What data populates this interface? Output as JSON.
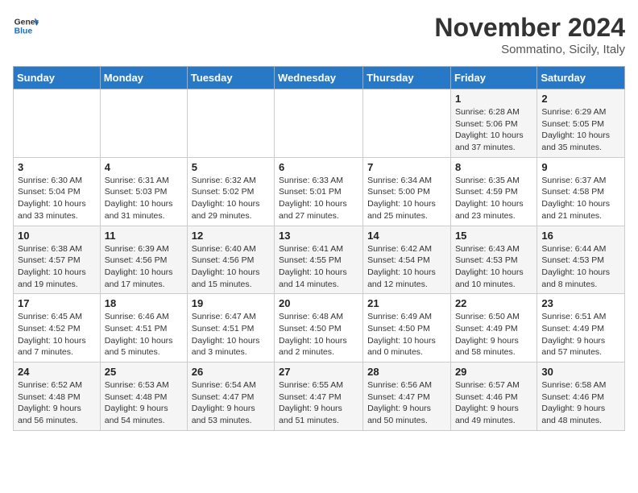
{
  "logo": {
    "line1": "General",
    "line2": "Blue"
  },
  "title": "November 2024",
  "location": "Sommatino, Sicily, Italy",
  "weekdays": [
    "Sunday",
    "Monday",
    "Tuesday",
    "Wednesday",
    "Thursday",
    "Friday",
    "Saturday"
  ],
  "weeks": [
    [
      {
        "day": "",
        "info": ""
      },
      {
        "day": "",
        "info": ""
      },
      {
        "day": "",
        "info": ""
      },
      {
        "day": "",
        "info": ""
      },
      {
        "day": "",
        "info": ""
      },
      {
        "day": "1",
        "info": "Sunrise: 6:28 AM\nSunset: 5:06 PM\nDaylight: 10 hours\nand 37 minutes."
      },
      {
        "day": "2",
        "info": "Sunrise: 6:29 AM\nSunset: 5:05 PM\nDaylight: 10 hours\nand 35 minutes."
      }
    ],
    [
      {
        "day": "3",
        "info": "Sunrise: 6:30 AM\nSunset: 5:04 PM\nDaylight: 10 hours\nand 33 minutes."
      },
      {
        "day": "4",
        "info": "Sunrise: 6:31 AM\nSunset: 5:03 PM\nDaylight: 10 hours\nand 31 minutes."
      },
      {
        "day": "5",
        "info": "Sunrise: 6:32 AM\nSunset: 5:02 PM\nDaylight: 10 hours\nand 29 minutes."
      },
      {
        "day": "6",
        "info": "Sunrise: 6:33 AM\nSunset: 5:01 PM\nDaylight: 10 hours\nand 27 minutes."
      },
      {
        "day": "7",
        "info": "Sunrise: 6:34 AM\nSunset: 5:00 PM\nDaylight: 10 hours\nand 25 minutes."
      },
      {
        "day": "8",
        "info": "Sunrise: 6:35 AM\nSunset: 4:59 PM\nDaylight: 10 hours\nand 23 minutes."
      },
      {
        "day": "9",
        "info": "Sunrise: 6:37 AM\nSunset: 4:58 PM\nDaylight: 10 hours\nand 21 minutes."
      }
    ],
    [
      {
        "day": "10",
        "info": "Sunrise: 6:38 AM\nSunset: 4:57 PM\nDaylight: 10 hours\nand 19 minutes."
      },
      {
        "day": "11",
        "info": "Sunrise: 6:39 AM\nSunset: 4:56 PM\nDaylight: 10 hours\nand 17 minutes."
      },
      {
        "day": "12",
        "info": "Sunrise: 6:40 AM\nSunset: 4:56 PM\nDaylight: 10 hours\nand 15 minutes."
      },
      {
        "day": "13",
        "info": "Sunrise: 6:41 AM\nSunset: 4:55 PM\nDaylight: 10 hours\nand 14 minutes."
      },
      {
        "day": "14",
        "info": "Sunrise: 6:42 AM\nSunset: 4:54 PM\nDaylight: 10 hours\nand 12 minutes."
      },
      {
        "day": "15",
        "info": "Sunrise: 6:43 AM\nSunset: 4:53 PM\nDaylight: 10 hours\nand 10 minutes."
      },
      {
        "day": "16",
        "info": "Sunrise: 6:44 AM\nSunset: 4:53 PM\nDaylight: 10 hours\nand 8 minutes."
      }
    ],
    [
      {
        "day": "17",
        "info": "Sunrise: 6:45 AM\nSunset: 4:52 PM\nDaylight: 10 hours\nand 7 minutes."
      },
      {
        "day": "18",
        "info": "Sunrise: 6:46 AM\nSunset: 4:51 PM\nDaylight: 10 hours\nand 5 minutes."
      },
      {
        "day": "19",
        "info": "Sunrise: 6:47 AM\nSunset: 4:51 PM\nDaylight: 10 hours\nand 3 minutes."
      },
      {
        "day": "20",
        "info": "Sunrise: 6:48 AM\nSunset: 4:50 PM\nDaylight: 10 hours\nand 2 minutes."
      },
      {
        "day": "21",
        "info": "Sunrise: 6:49 AM\nSunset: 4:50 PM\nDaylight: 10 hours\nand 0 minutes."
      },
      {
        "day": "22",
        "info": "Sunrise: 6:50 AM\nSunset: 4:49 PM\nDaylight: 9 hours\nand 58 minutes."
      },
      {
        "day": "23",
        "info": "Sunrise: 6:51 AM\nSunset: 4:49 PM\nDaylight: 9 hours\nand 57 minutes."
      }
    ],
    [
      {
        "day": "24",
        "info": "Sunrise: 6:52 AM\nSunset: 4:48 PM\nDaylight: 9 hours\nand 56 minutes."
      },
      {
        "day": "25",
        "info": "Sunrise: 6:53 AM\nSunset: 4:48 PM\nDaylight: 9 hours\nand 54 minutes."
      },
      {
        "day": "26",
        "info": "Sunrise: 6:54 AM\nSunset: 4:47 PM\nDaylight: 9 hours\nand 53 minutes."
      },
      {
        "day": "27",
        "info": "Sunrise: 6:55 AM\nSunset: 4:47 PM\nDaylight: 9 hours\nand 51 minutes."
      },
      {
        "day": "28",
        "info": "Sunrise: 6:56 AM\nSunset: 4:47 PM\nDaylight: 9 hours\nand 50 minutes."
      },
      {
        "day": "29",
        "info": "Sunrise: 6:57 AM\nSunset: 4:46 PM\nDaylight: 9 hours\nand 49 minutes."
      },
      {
        "day": "30",
        "info": "Sunrise: 6:58 AM\nSunset: 4:46 PM\nDaylight: 9 hours\nand 48 minutes."
      }
    ]
  ]
}
